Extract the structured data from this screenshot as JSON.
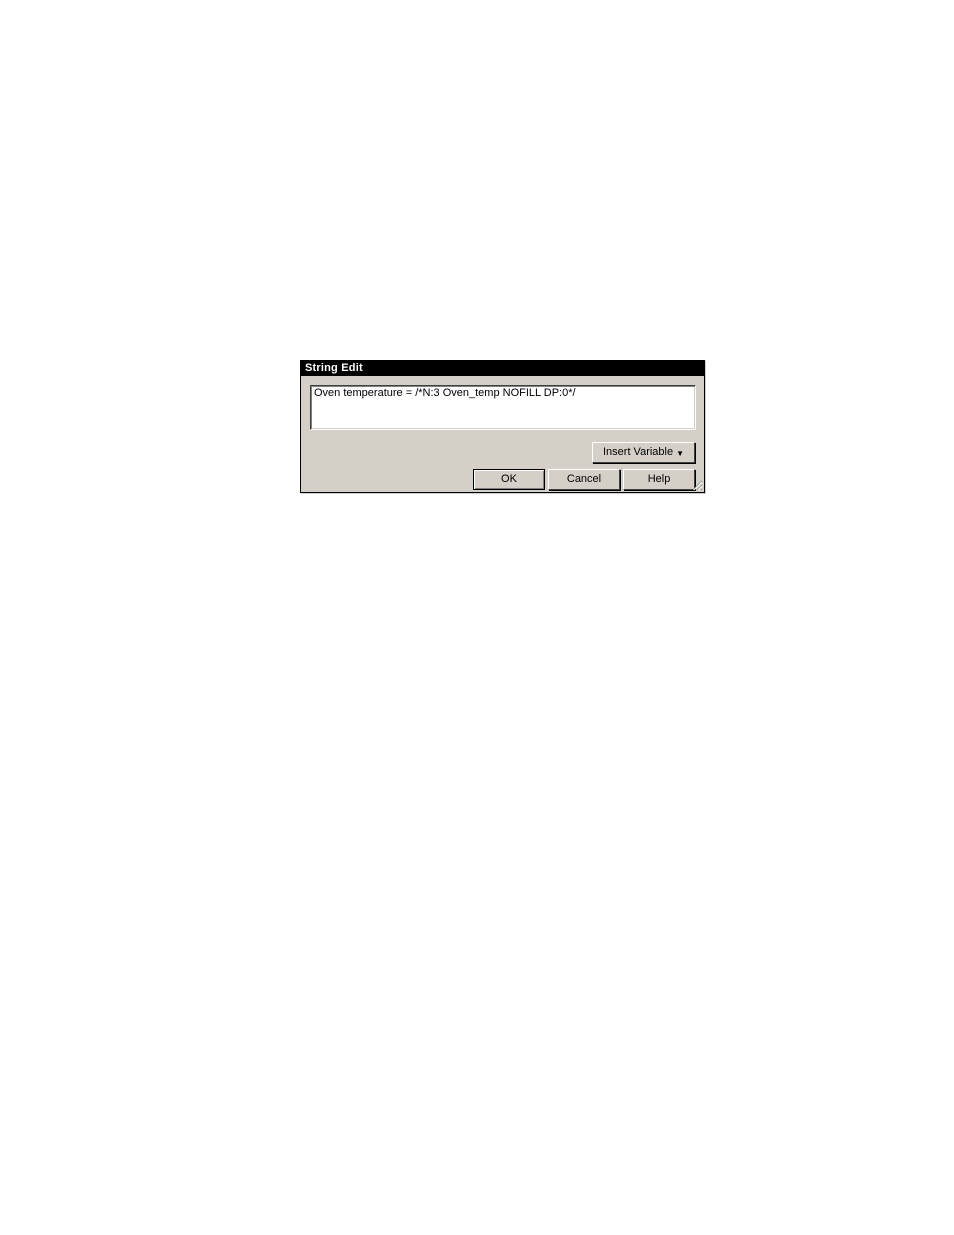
{
  "dialog": {
    "title": "String Edit",
    "textarea_value": "Oven temperature = /*N:3 Oven_temp NOFILL DP:0*/",
    "buttons": {
      "insert_variable": "Insert Variable",
      "ok": "OK",
      "cancel": "Cancel",
      "help": "Help"
    }
  }
}
